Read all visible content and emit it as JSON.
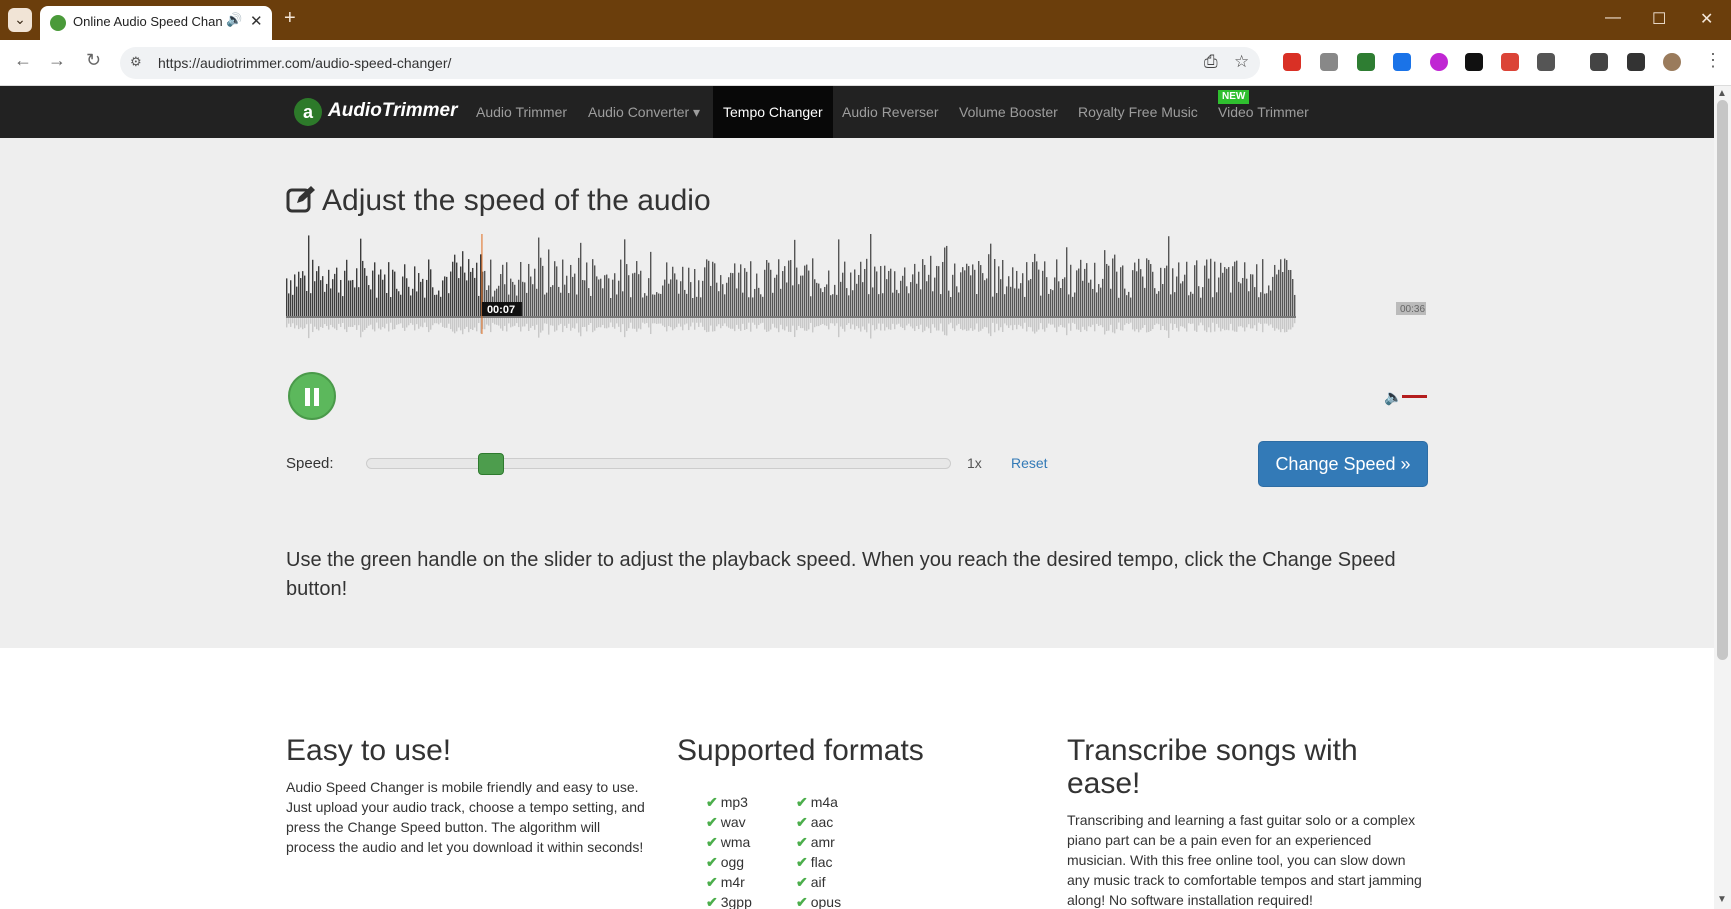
{
  "browser": {
    "tab_title": "Online Audio Speed Changer",
    "tab_audio_icon": "speaker-icon",
    "url": "https://audiotrimmer.com/audio-speed-changer/",
    "accent_color": "#6b3e0c"
  },
  "navbar": {
    "brand": "AudioTrimmer",
    "items": [
      {
        "label": "Audio Trimmer"
      },
      {
        "label": "Audio Converter ▾"
      },
      {
        "label": "Tempo Changer",
        "active": true
      },
      {
        "label": "Audio Reverser"
      },
      {
        "label": "Volume Booster"
      },
      {
        "label": "Royalty Free Music"
      },
      {
        "label": "Video Trimmer"
      }
    ],
    "new_badge": "NEW"
  },
  "hero": {
    "title": "Adjust the speed of the audio",
    "current_time": "00:07",
    "total_time": "00:36",
    "playback_progress": 0.194,
    "speed_label": "Speed:",
    "speed_value": "1x",
    "speed_slider_fraction": 0.2,
    "reset_label": "Reset",
    "change_button": "Change Speed »",
    "description": "Use the green handle on the slider to adjust the playback speed. When you reach the desired tempo, click the Change Speed button!"
  },
  "features": {
    "easy": {
      "title": "Easy to use!",
      "text": "Audio Speed Changer is mobile friendly and easy to use. Just upload your audio track, choose a tempo setting, and press the Change Speed button. The algorithm will process the audio and let you download it within seconds!"
    },
    "formats": {
      "title": "Supported formats",
      "col1": [
        "mp3",
        "wav",
        "wma",
        "ogg",
        "m4r",
        "3gpp"
      ],
      "col2": [
        "m4a",
        "aac",
        "amr",
        "flac",
        "aif",
        "opus"
      ]
    },
    "transcribe": {
      "title": "Transcribe songs with ease!",
      "text": "Transcribing and learning a fast guitar solo or a complex piano part can be a pain even for an experienced musician. With this free online tool, you can slow down any music track to comfortable tempos and start jamming along! No software installation required!"
    }
  },
  "colors": {
    "green": "#5cb85c",
    "blue": "#337ab7",
    "navbar": "#222222",
    "hero_bg": "#eeeeee"
  }
}
